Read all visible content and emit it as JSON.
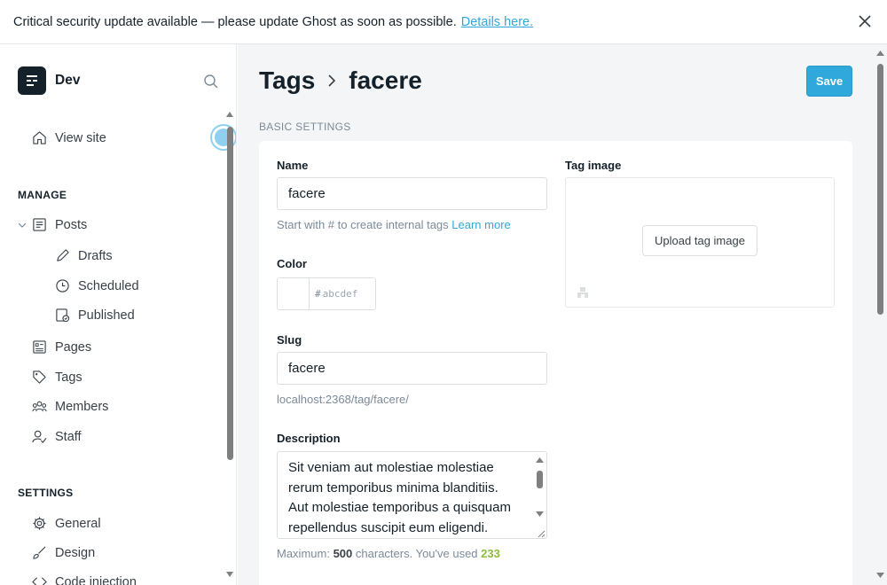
{
  "banner": {
    "message": "Critical security update available — please update Ghost as soon as possible.",
    "link": "Details here."
  },
  "sidebar": {
    "site_name": "Dev",
    "view_site": "View site",
    "manage_title": "MANAGE",
    "posts": "Posts",
    "drafts": "Drafts",
    "scheduled": "Scheduled",
    "published": "Published",
    "pages": "Pages",
    "tags": "Tags",
    "members": "Members",
    "staff": "Staff",
    "settings_title": "SETTINGS",
    "general": "General",
    "design": "Design",
    "code_injection": "Code injection"
  },
  "header": {
    "crumb_parent": "Tags",
    "crumb_current": "facere",
    "save_label": "Save"
  },
  "form": {
    "section_title": "BASIC SETTINGS",
    "name_label": "Name",
    "name_value": "facere",
    "name_hint": "Start with # to create internal tags",
    "name_hint_link": "Learn more",
    "color_label": "Color",
    "color_hash": "#",
    "color_placeholder": "abcdef",
    "slug_label": "Slug",
    "slug_value": "facere",
    "slug_url": "localhost:2368/tag/facere/",
    "description_label": "Description",
    "description_value": "Sit veniam aut molestiae molestiae rerum temporibus minima blanditiis. Aut molestiae temporibus a quisquam repellendus suscipit eum eligendi.",
    "counter_prefix": "Maximum:",
    "counter_max": "500",
    "counter_mid": "characters. You've used",
    "counter_used": "233",
    "image_label": "Tag image",
    "upload_label": "Upload tag image"
  },
  "colors": {
    "accent": "#30a8db",
    "text": "#15212a",
    "muted": "#7c8b9a",
    "success": "#8fbd3d"
  }
}
